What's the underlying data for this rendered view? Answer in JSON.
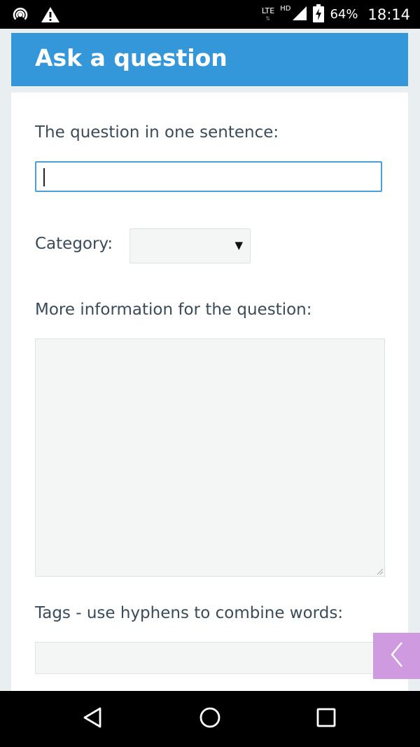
{
  "status_bar": {
    "network_type": "LTE",
    "network_arrows": "⇅",
    "hd_label": "HD",
    "battery_percent": "64%",
    "time": "18:14"
  },
  "header": {
    "title": "Ask a question"
  },
  "form": {
    "question_label": "The question in one sentence:",
    "question_value": "",
    "category_label": "Category:",
    "category_selected": "",
    "category_arrow": "▼",
    "more_info_label": "More information for the question:",
    "more_info_value": "",
    "tags_label": "Tags - use hyphens to combine words:",
    "tags_value": ""
  },
  "side_tab": {
    "icon": "chevron-left-icon",
    "color": "#cf9adf"
  },
  "nav_bar": {
    "back_icon": "back-triangle-icon",
    "home_icon": "home-circle-icon",
    "recents_icon": "recents-square-icon"
  },
  "colors": {
    "header": "#3497da",
    "input_focus_border": "#4a9fd8",
    "label_text": "#3a4b5a",
    "page_background": "#e9eef0"
  }
}
